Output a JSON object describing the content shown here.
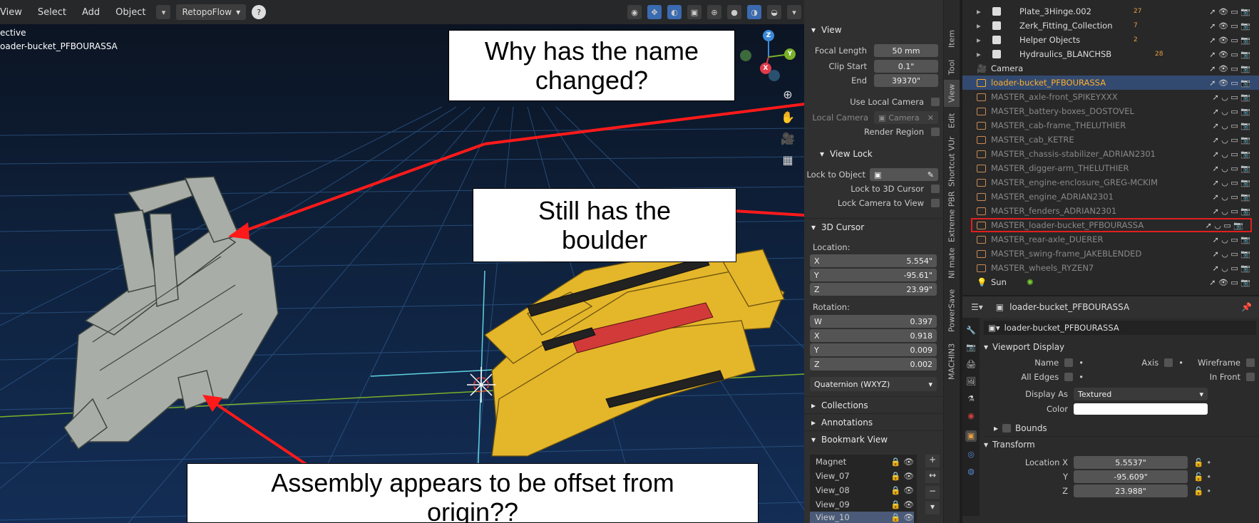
{
  "viewport": {
    "menu": [
      "View",
      "Select",
      "Add",
      "Object"
    ],
    "retopo": "RetopoFlow",
    "mode_label": "ective",
    "object_label": "oader-bucket_PFBOURASSA",
    "gizmo": {
      "z": "Z",
      "y": "Y",
      "x": "X"
    }
  },
  "callouts": {
    "name_changed": "Why has the name changed?",
    "boulder": "Still has the boulder",
    "offset": "Assembly appears to be offset from origin??"
  },
  "npanel": {
    "view_header": "View",
    "focal_length_label": "Focal Length",
    "focal_length": "50 mm",
    "clip_start_label": "Clip Start",
    "clip_start": "0.1\"",
    "end_label": "End",
    "end": "39370\"",
    "use_local_camera": "Use Local Camera",
    "local_camera_label": "Local Camera",
    "local_camera": "Camera",
    "render_region": "Render Region",
    "view_lock": "View Lock",
    "lock_to_object": "Lock to Object",
    "lock_3d_cursor": "Lock to 3D Cursor",
    "lock_camera": "Lock Camera to View",
    "cursor_header": "3D Cursor",
    "location_label": "Location:",
    "loc": [
      {
        "a": "X",
        "v": "5.554\""
      },
      {
        "a": "Y",
        "v": "-95.61\""
      },
      {
        "a": "Z",
        "v": "23.99\""
      }
    ],
    "rotation_label": "Rotation:",
    "rot": [
      {
        "a": "W",
        "v": "0.397"
      },
      {
        "a": "X",
        "v": "0.918"
      },
      {
        "a": "Y",
        "v": "0.009"
      },
      {
        "a": "Z",
        "v": "0.002"
      }
    ],
    "rot_mode": "Quaternion (WXYZ)",
    "collections": "Collections",
    "annotations": "Annotations",
    "bookmark_view": "Bookmark View",
    "bookmarks": [
      "Magnet",
      "View_07",
      "View_08",
      "View_09",
      "View_10"
    ]
  },
  "tabs": [
    "Item",
    "Tool",
    "View",
    "Edit",
    "Shortcut VUr",
    "Extreme PBR",
    "NI mate",
    "PowerSave",
    "MACHIN3"
  ],
  "outliner": {
    "top_rows": [
      {
        "label": "Plate_3Hinge.002",
        "badge": "27"
      },
      {
        "label": "Zerk_Fitting_Collection",
        "badge": "7"
      },
      {
        "label": "Helper Objects",
        "badge": "2"
      },
      {
        "label": "Hydraulics_BLANCHSB",
        "badge": "28"
      }
    ],
    "camera": "Camera",
    "selected": "loader-bucket_PFBOURASSA",
    "masters": [
      "MASTER_axle-front_SPIKEYXXX",
      "MASTER_battery-boxes_DOSTOVEL",
      "MASTER_cab-frame_THELUTHIER",
      "MASTER_cab_KETRE",
      "MASTER_chassis-stabilizer_ADRIAN2301",
      "MASTER_digger-arm_THELUTHIER",
      "MASTER_engine-enclosure_GREG-MCKIM",
      "MASTER_engine_ADRIAN2301",
      "MASTER_fenders_ADRIAN2301",
      "MASTER_loader-bucket_PFBOURASSA",
      "MASTER_rear-axle_DUERER",
      "MASTER_swing-frame_JAKEBLENDED",
      "MASTER_wheels_RYZEN7"
    ],
    "sun": "Sun"
  },
  "properties": {
    "object_name": "loader-bucket_PFBOURASSA",
    "data_name": "loader-bucket_PFBOURASSA",
    "viewport_display": "Viewport Display",
    "name": "Name",
    "axis": "Axis",
    "wireframe": "Wireframe",
    "all_edges": "All Edges",
    "in_front": "In Front",
    "display_as_label": "Display As",
    "display_as": "Textured",
    "color_label": "Color",
    "bounds": "Bounds",
    "transform": "Transform",
    "location_x_label": "Location X",
    "location_x": "5.5537\"",
    "y_label": "Y",
    "location_y": "-95.609\"",
    "z_label": "Z",
    "location_z": "23.988\""
  },
  "colors": {
    "arrow": "#ff1a1a",
    "bucket": "#a9ada8",
    "arm": "#e4b62a",
    "cylinder": "#d23a3a",
    "selected": "#ffaf29"
  }
}
